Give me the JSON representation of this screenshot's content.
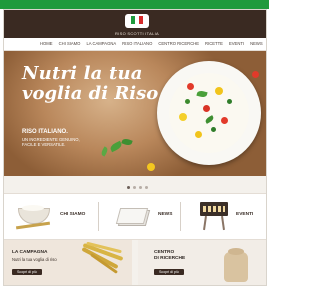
{
  "header": {
    "brand_name": "RISO SCOTTI ITALIA"
  },
  "nav": {
    "items": [
      "HOME",
      "CHI SIAMO",
      "LA CAMPAGNA",
      "RISO ITALIANO",
      "CENTRO RICERCHE",
      "RICETTE",
      "EVENTI",
      "NEWS"
    ]
  },
  "hero": {
    "title_line1": "Nutri la tua",
    "title_line2": "voglia di Riso",
    "subtitle": "RISO ITALIANO.",
    "tagline": "UN INGREDIENTE GENUINO, FACILE E VERSATILE."
  },
  "features": [
    {
      "label": "CHI SIAMO"
    },
    {
      "label": "NEWS"
    },
    {
      "label": "EVENTI"
    }
  ],
  "bottom": {
    "left": {
      "title": "LA CAMPAGNA",
      "subtitle": "Nutri la tua voglia di riso",
      "button": "Scopri di più"
    },
    "right": {
      "title_line1": "CENTRO",
      "title_line2": "DI RICERCHE",
      "button": "Scopri di più"
    }
  },
  "colors": {
    "top_bar": "#1f9a3c",
    "header": "#3a2a22"
  }
}
